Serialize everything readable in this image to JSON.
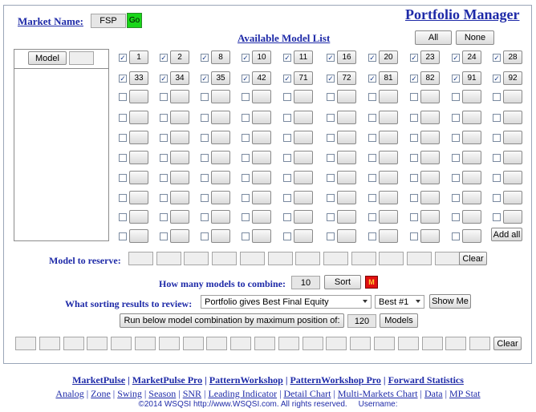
{
  "header": {
    "market_label": "Market Name:",
    "market_value": "FSP",
    "go_label": "Go",
    "title": "Portfolio Manager",
    "available_list_title": "Available Model List",
    "all_label": "All",
    "none_label": "None"
  },
  "left_panel": {
    "model_button_label": "Model",
    "model_value": ""
  },
  "grid": {
    "checked_models": [
      "1",
      "2",
      "8",
      "10",
      "11",
      "16",
      "20",
      "23",
      "24",
      "28",
      "33",
      "34",
      "35",
      "42",
      "71",
      "72",
      "81",
      "82",
      "91",
      "92"
    ],
    "empty_rows": 8,
    "columns": 10,
    "add_all_label": "Add all"
  },
  "reserve": {
    "label": "Model to reserve:",
    "slots": 12,
    "clear_label": "Clear"
  },
  "combine": {
    "label": "How many models to combine:",
    "value": "10",
    "sort_label": "Sort",
    "marker": "M"
  },
  "review": {
    "label": "What sorting results to review:",
    "criterion": "Portfolio gives Best Final Equity",
    "rank": "Best #1",
    "show_label": "Show Me"
  },
  "run": {
    "label": "Run below model combination by maximum position of:",
    "value": "120",
    "models_label": "Models"
  },
  "result": {
    "slots": 20,
    "clear_label": "Clear"
  },
  "footer": {
    "primary_links": [
      "MarketPulse",
      "MarketPulse Pro",
      "PatternWorkshop",
      "PatternWorkshop Pro",
      "Forward Statistics"
    ],
    "secondary_links": [
      "Analog",
      "Zone",
      "Swing",
      "Season",
      "SNR",
      "Leading Indicator",
      "Detail Chart",
      "Multi-Markets Chart",
      "Data",
      "MP Stat"
    ],
    "copyright": "©2014 WSQSI http://www.WSQSI.com. All rights reserved.",
    "username_label": "Username:"
  },
  "colors": {
    "link_blue": "#1e2aa8",
    "go_green": "#19d619",
    "marker_red": "#e01010"
  }
}
